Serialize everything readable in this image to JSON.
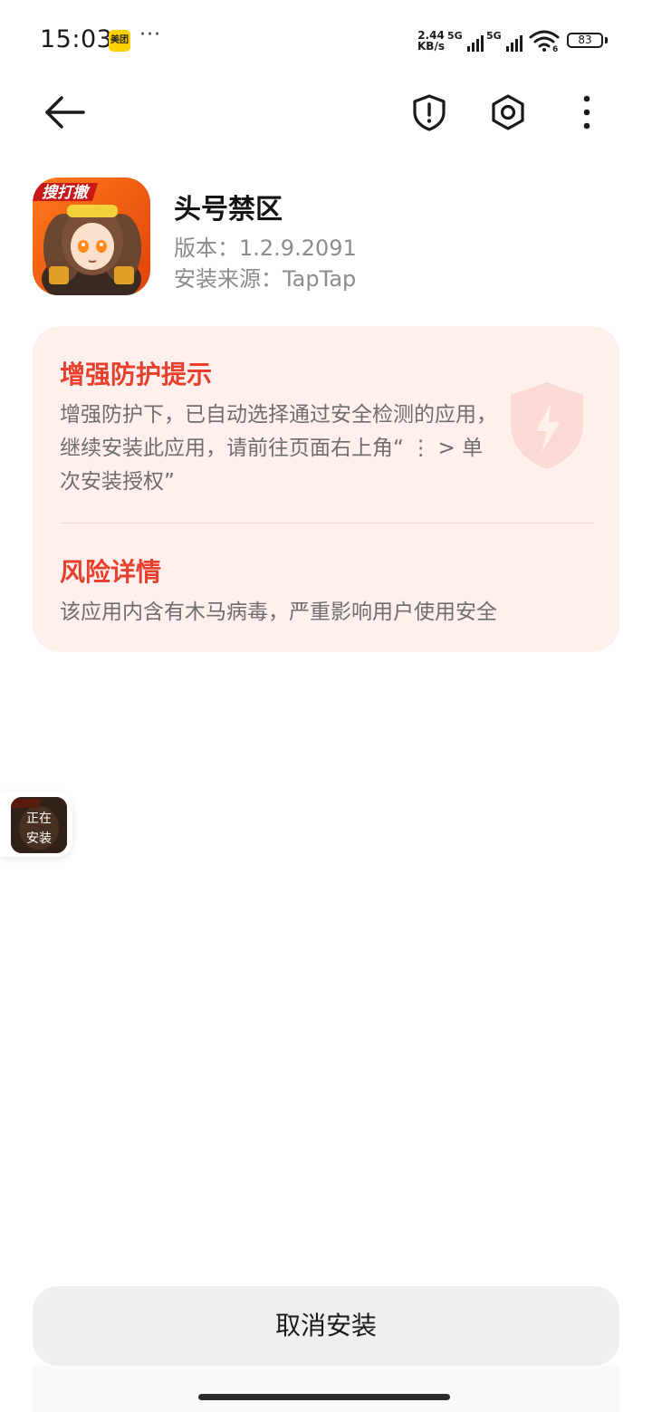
{
  "status_bar": {
    "time": "15:03",
    "notification_app": "美团",
    "more_dots": "···",
    "net_speed_value": "2.44",
    "net_speed_unit": "KB/s",
    "sim1_tag": "5G",
    "sim2_tag": "5G",
    "wifi_tag": "6",
    "battery_percent": "83",
    "icons": [
      "meituan-app-icon",
      "signal-icon",
      "signal-icon",
      "wifi-icon",
      "battery-icon"
    ]
  },
  "toolbar": {
    "icons": [
      "back-arrow-icon",
      "shield-alert-icon",
      "settings-hex-icon",
      "more-vertical-icon"
    ]
  },
  "app": {
    "name": "头号禁区",
    "version_line": "版本：1.2.9.2091",
    "source_line": "安装来源：TapTap",
    "icon_badge_text": "搜打撤"
  },
  "warning_card": {
    "title": "增强防护提示",
    "body": "增强防护下，已自动选择通过安全检测的应用，继续安装此应用，请前往页面右上角“ ⋮ > 单次安装授权”",
    "risk_title": "风险详情",
    "risk_body": "该应用内含有木马病毒，严重影响用户使用安全",
    "accent_color": "#e8402f",
    "background_color": "#fff0ee"
  },
  "float_bubble": {
    "line1": "正在",
    "line2": "安装"
  },
  "actions": {
    "cancel_label": "取消安装"
  }
}
